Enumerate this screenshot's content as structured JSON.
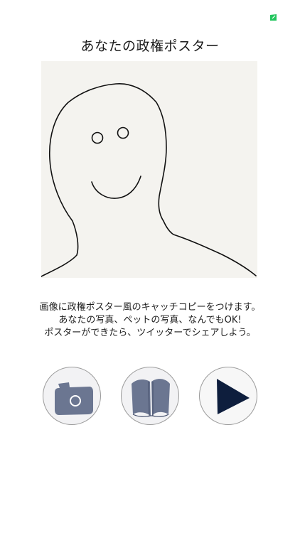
{
  "header": {
    "title": "あなたの政権ポスター",
    "status_icon": "green-flag-icon",
    "status_color": "#22c55e"
  },
  "canvas": {
    "background_color": "#f4f3ef",
    "drawing": "smiley-face-sketch-icon"
  },
  "description": {
    "lines": [
      "画像に政権ポスター風のキャッチコピーをつけます。",
      "あなたの写真、ペットの写真、なんでもOK!",
      "ポスターができたら、ツイッターでシェアしよう。"
    ]
  },
  "actions": [
    {
      "icon": "camera-icon",
      "color": "#6b7691"
    },
    {
      "icon": "book-icon",
      "color": "#6b7691"
    },
    {
      "icon": "play-icon",
      "color": "#0e1e3d"
    }
  ]
}
